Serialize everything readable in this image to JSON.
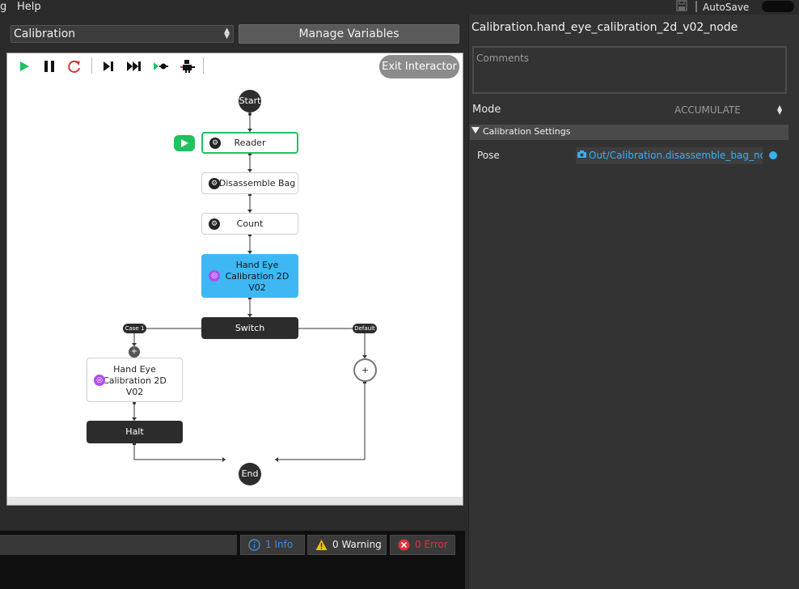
{
  "menu": {
    "items": [
      "g",
      "Help"
    ]
  },
  "header": {
    "autosave_label": "AutoSave"
  },
  "flow": {
    "selected": "Calibration",
    "manage_variables_label": "Manage Variables"
  },
  "canvas": {
    "exit_label": "Exit Interactor",
    "nodes": {
      "start": "Start",
      "reader": "Reader",
      "disassemble": "Disassemble Bag",
      "count": "Count",
      "hand_eye_main": [
        "Hand Eye",
        "Calibration 2D",
        "V02"
      ],
      "switch": "Switch",
      "case1": "Case 1",
      "default": "Default",
      "plus": "+",
      "hand_eye_case": [
        "Hand Eye",
        "Calibration 2D",
        "V02"
      ],
      "halt": "Halt",
      "end": "End"
    }
  },
  "log": {
    "info": "1 Info",
    "warning": "0 Warning",
    "error": "0 Error"
  },
  "properties": {
    "title": "Calibration.hand_eye_calibration_2d_v02_node",
    "comments_placeholder": "Comments",
    "mode_label": "Mode",
    "mode_value": "ACCUMULATE",
    "section": "Calibration Settings",
    "pose_label": "Pose",
    "pose_value": "Out/Calibration.disassemble_bag_noc"
  },
  "colors": {
    "accent_blue": "#3ab0f0",
    "selected_node": "#3db8f5",
    "active_green": "#1ec25e",
    "error_red": "#e0313a",
    "warning_yellow": "#f2c200"
  }
}
